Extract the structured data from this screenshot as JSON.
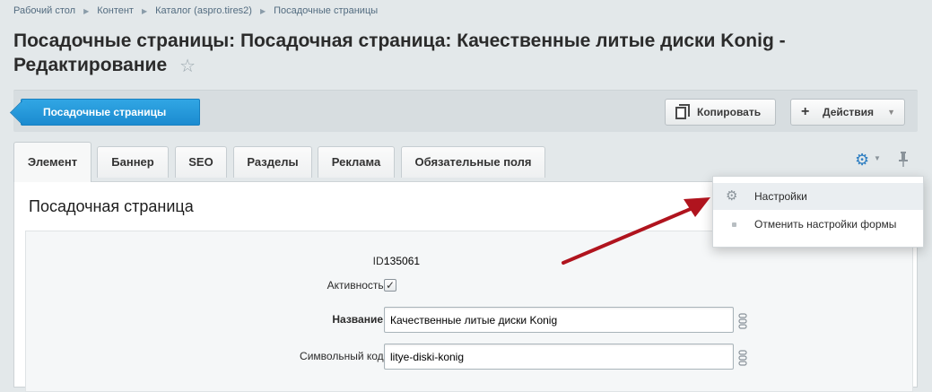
{
  "breadcrumb": [
    "Рабочий стол",
    "Контент",
    "Каталог (aspro.tires2)",
    "Посадочные страницы"
  ],
  "page": {
    "title": "Посадочные страницы: Посадочная страница: Качественные литые диски Konig - Редактирование"
  },
  "toolbar": {
    "back_label": "Посадочные страницы",
    "copy_label": "Копировать",
    "actions_label": "Действия"
  },
  "tabs": [
    {
      "label": "Элемент",
      "active": true
    },
    {
      "label": "Баннер",
      "active": false
    },
    {
      "label": "SEO",
      "active": false
    },
    {
      "label": "Разделы",
      "active": false
    },
    {
      "label": "Реклама",
      "active": false
    },
    {
      "label": "Обязательные поля",
      "active": false
    }
  ],
  "section": {
    "title": "Посадочная страница"
  },
  "form": {
    "id_label": "ID:",
    "id_value": "135061",
    "active_label": "Активность:",
    "active_checked": true,
    "name_label": "Название:",
    "name_value": "Качественные литые диски Konig",
    "code_label": "Символьный код:",
    "code_value": "litye-diski-konig"
  },
  "settings_menu": {
    "items": [
      {
        "label": "Настройки",
        "icon": "gear-icon"
      },
      {
        "label": "Отменить настройки формы",
        "icon": "dot-icon"
      }
    ]
  },
  "colors": {
    "accent": "#1b8bd0",
    "annotation_arrow": "#b0141e",
    "background": "#e3e8ea"
  }
}
